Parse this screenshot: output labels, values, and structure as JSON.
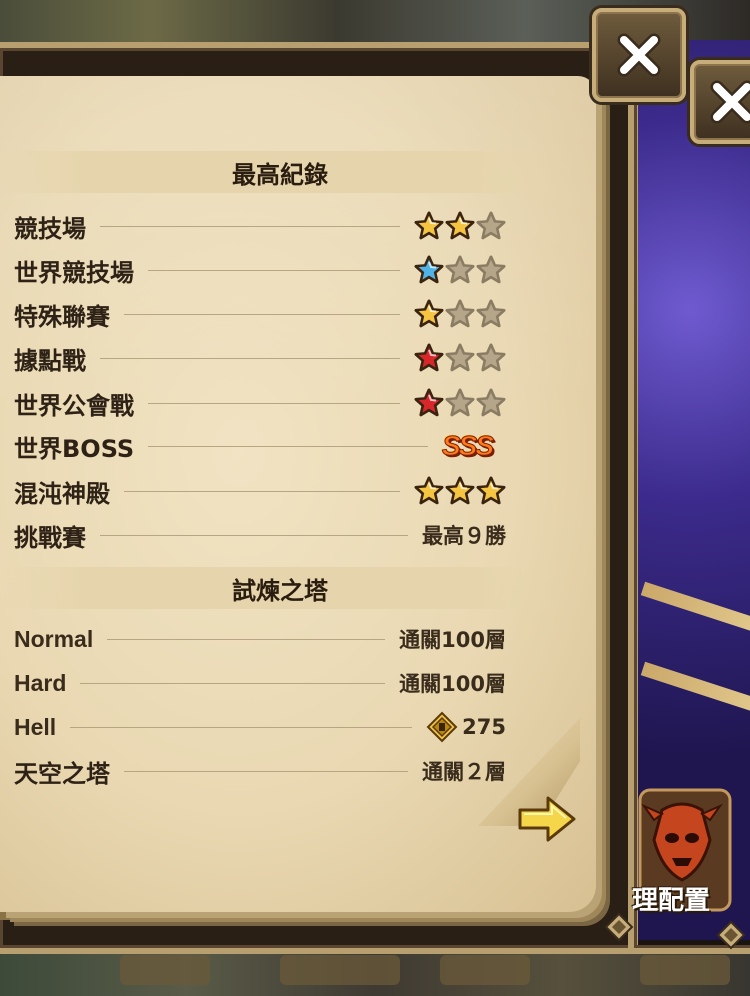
{
  "sections": [
    {
      "title": "最高紀錄",
      "rows": [
        {
          "label": "競技場",
          "type": "stars",
          "stars": [
            "gold",
            "gold",
            "empty"
          ]
        },
        {
          "label": "世界競技場",
          "type": "stars",
          "stars": [
            "blue",
            "empty",
            "empty"
          ]
        },
        {
          "label": "特殊聯賽",
          "type": "stars",
          "stars": [
            "gold",
            "empty",
            "empty"
          ]
        },
        {
          "label": "據點戰",
          "type": "stars",
          "stars": [
            "red",
            "empty",
            "empty"
          ]
        },
        {
          "label": "世界公會戰",
          "type": "stars",
          "stars": [
            "red",
            "empty",
            "empty"
          ]
        },
        {
          "label": "世界BOSS",
          "type": "rank",
          "value": "SSS"
        },
        {
          "label": "混沌神殿",
          "type": "stars",
          "stars": [
            "gold",
            "gold",
            "gold"
          ]
        },
        {
          "label": "挑戰賽",
          "type": "text",
          "value": "最高９勝"
        }
      ]
    },
    {
      "title": "試煉之塔",
      "rows": [
        {
          "label": "Normal",
          "type": "text",
          "value": "通關100層"
        },
        {
          "label": "Hard",
          "type": "text",
          "value": "通關100層"
        },
        {
          "label": "Hell",
          "type": "gem",
          "value": "275"
        },
        {
          "label": "天空之塔",
          "type": "text",
          "value": "通關２層"
        }
      ]
    }
  ],
  "side_panel": {
    "label": "理配置",
    "icon": "demon-mask-icon"
  },
  "buttons": {
    "close": "close-icon",
    "next": "arrow-right-icon"
  },
  "colors": {
    "gold_star": "#f5c542",
    "blue_star": "#4fb3e8",
    "red_star": "#d8272b",
    "empty_star": "#b5a68a"
  }
}
